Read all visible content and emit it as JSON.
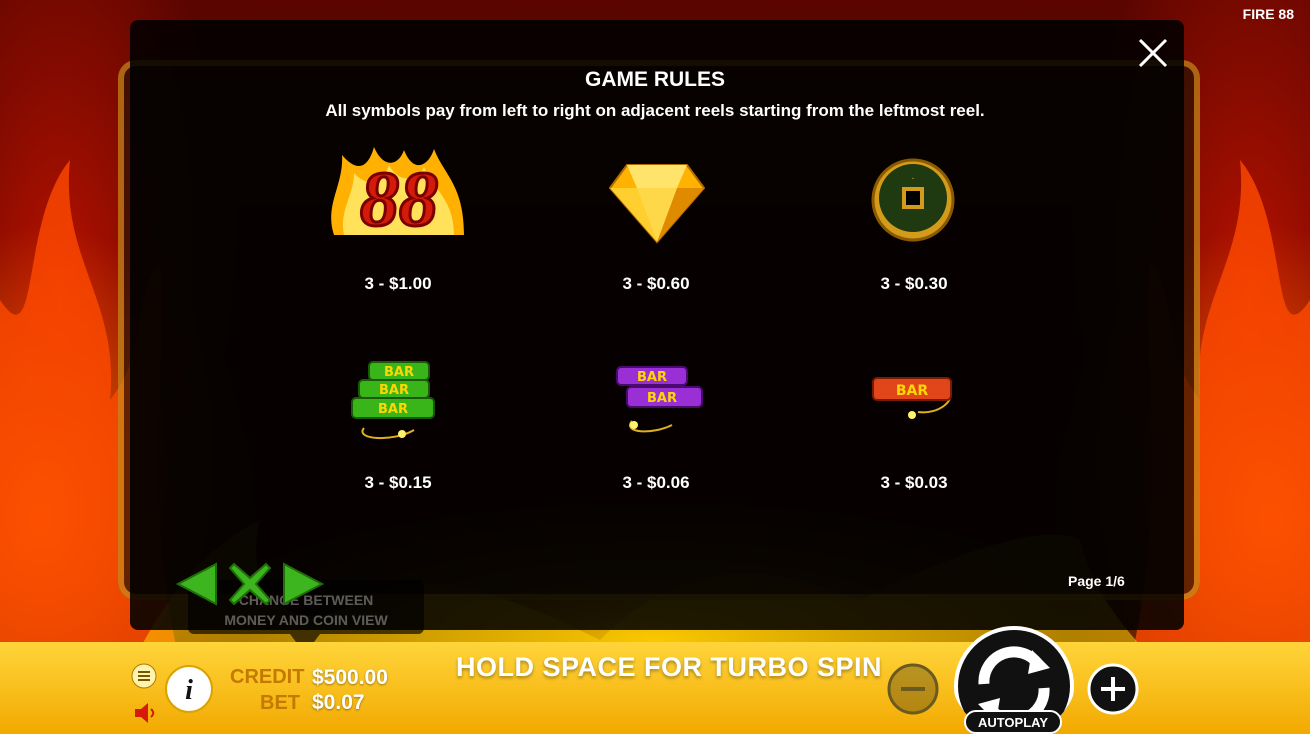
{
  "game_title": "FIRE 88",
  "rules": {
    "title": "GAME RULES",
    "description": "All symbols pay from left to right on adjacent reels starting from the leftmost reel.",
    "page": "Page 1/6"
  },
  "paytable": [
    {
      "symbol": "fire-88",
      "payout": "3 - $1.00"
    },
    {
      "symbol": "gold-diamond",
      "payout": "3 - $0.60"
    },
    {
      "symbol": "jade-coin",
      "payout": "3 - $0.30"
    },
    {
      "symbol": "green-triple-bar",
      "payout": "3 - $0.15"
    },
    {
      "symbol": "purple-double-bar",
      "payout": "3 - $0.06"
    },
    {
      "symbol": "red-single-bar",
      "payout": "3 - $0.03"
    }
  ],
  "tooltip": {
    "line1": "CHANGE BETWEEN",
    "line2": "MONEY AND COIN VIEW"
  },
  "status": {
    "credit_label": "CREDIT",
    "credit_value": "$500.00",
    "bet_label": "BET",
    "bet_value": "$0.07",
    "turbo_hint": "HOLD SPACE FOR TURBO SPIN",
    "autoplay_label": "AUTOPLAY"
  },
  "colors": {
    "accent_gold": "#f2a900",
    "nav_green": "#3db51f",
    "label_orange": "#c47a00"
  }
}
